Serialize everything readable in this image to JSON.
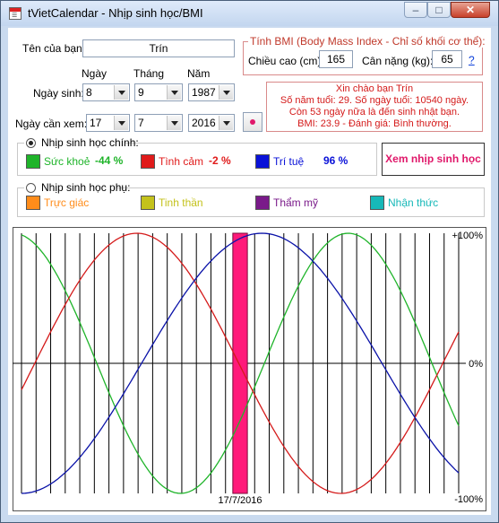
{
  "window": {
    "title": "tVietCalendar - Nhịp sinh học/BMI",
    "minimize": "–",
    "maximize": "□",
    "close": "✕",
    "icon": "calendar-icon"
  },
  "form": {
    "name_label": "Tên của bạn:",
    "name_value": "Trín",
    "day_header": "Ngày",
    "month_header": "Tháng",
    "year_header": "Năm",
    "birth_label": "Ngày sinh:",
    "birth_day": "8",
    "birth_month": "9",
    "birth_year": "1987",
    "view_label": "Ngày cần xem:",
    "view_day": "17",
    "view_month": "7",
    "view_year": "2016"
  },
  "bmi": {
    "legend": "Tính BMI (Body Mass Index - Chỉ số khối cơ thể):",
    "height_label": "Chiều cao (cm):",
    "height_value": "165",
    "weight_label": "Cân nặng (kg):",
    "weight_value": "65",
    "help": "?"
  },
  "info": {
    "line1": "Xin chào bạn Trín",
    "line2": "Số năm tuổi: 29. Số ngày tuổi: 10540 ngày.",
    "line3": "Còn 53 ngày nữa là đến sinh nhật bạn.",
    "line4": "BMI: 23.9 - Đánh giá: Bình thường."
  },
  "primary": {
    "label": "Nhịp sinh học chính:",
    "physical": {
      "label": "Sức khoẻ",
      "value": "-44 %",
      "color": "#1fb42a"
    },
    "emotional": {
      "label": "Tình cảm",
      "value": "-2 %",
      "color": "#e01b1b"
    },
    "intellectual": {
      "label": "Trí tuệ",
      "value": "96 %",
      "color": "#0a12d8"
    }
  },
  "view_button": "Xem nhịp sinh học",
  "secondary": {
    "label": "Nhịp sinh học phụ:",
    "intuitive": {
      "label": "Trực giác",
      "color": "#ff8c1a"
    },
    "spiritual": {
      "label": "Tinh thần",
      "color": "#c4c21c"
    },
    "aesthetic": {
      "label": "Thẩm mỹ",
      "color": "#7a1a8a"
    },
    "awareness": {
      "label": "Nhận thức",
      "color": "#16b8b8"
    }
  },
  "chart": {
    "top_label": "+100%",
    "mid_label": "0%",
    "bottom_label": "-100%",
    "date_label": "17/7/2016",
    "highlight_color": "#ff1a7a"
  },
  "chart_data": {
    "type": "line",
    "title": "",
    "xlabel": "17/7/2016",
    "ylabel": "",
    "ylim": [
      -100,
      100
    ],
    "yticks": [
      "+100%",
      "0%",
      "-100%"
    ],
    "days_before": 15,
    "days_after": 15,
    "current_day": "17/7/2016",
    "age_days": 10540,
    "series": [
      {
        "name": "Sức khoẻ",
        "period": 23,
        "color": "#1fb42a",
        "current": -44
      },
      {
        "name": "Tình cảm",
        "period": 28,
        "color": "#d41a1a",
        "current": -2
      },
      {
        "name": "Trí tuệ",
        "period": 33,
        "color": "#0a12a8",
        "current": 96
      }
    ]
  }
}
